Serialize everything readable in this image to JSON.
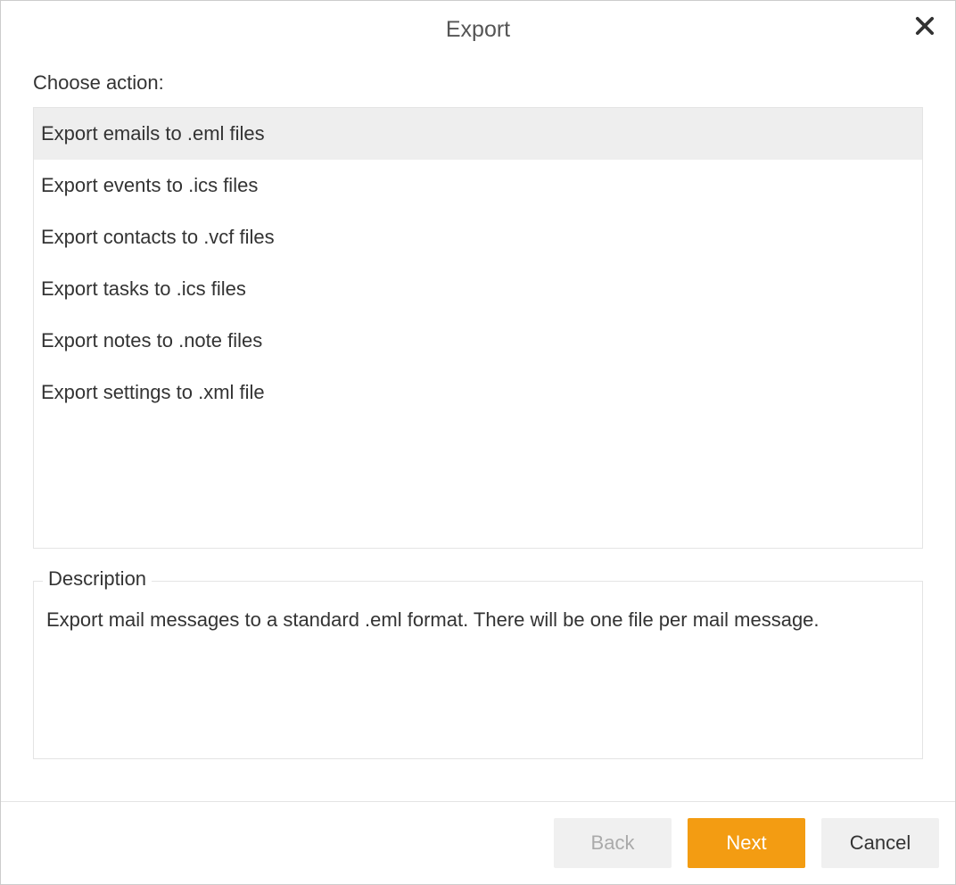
{
  "header": {
    "title": "Export"
  },
  "choose_label": "Choose action:",
  "actions": [
    {
      "label": "Export emails to .eml files",
      "selected": true
    },
    {
      "label": "Export events to .ics files",
      "selected": false
    },
    {
      "label": "Export contacts to .vcf files",
      "selected": false
    },
    {
      "label": "Export tasks to .ics files",
      "selected": false
    },
    {
      "label": "Export notes to .note files",
      "selected": false
    },
    {
      "label": "Export settings to .xml file",
      "selected": false
    }
  ],
  "description": {
    "legend": "Description",
    "text": "Export mail messages to a standard .eml format. There will be one file per mail message."
  },
  "footer": {
    "back": "Back",
    "next": "Next",
    "cancel": "Cancel"
  }
}
